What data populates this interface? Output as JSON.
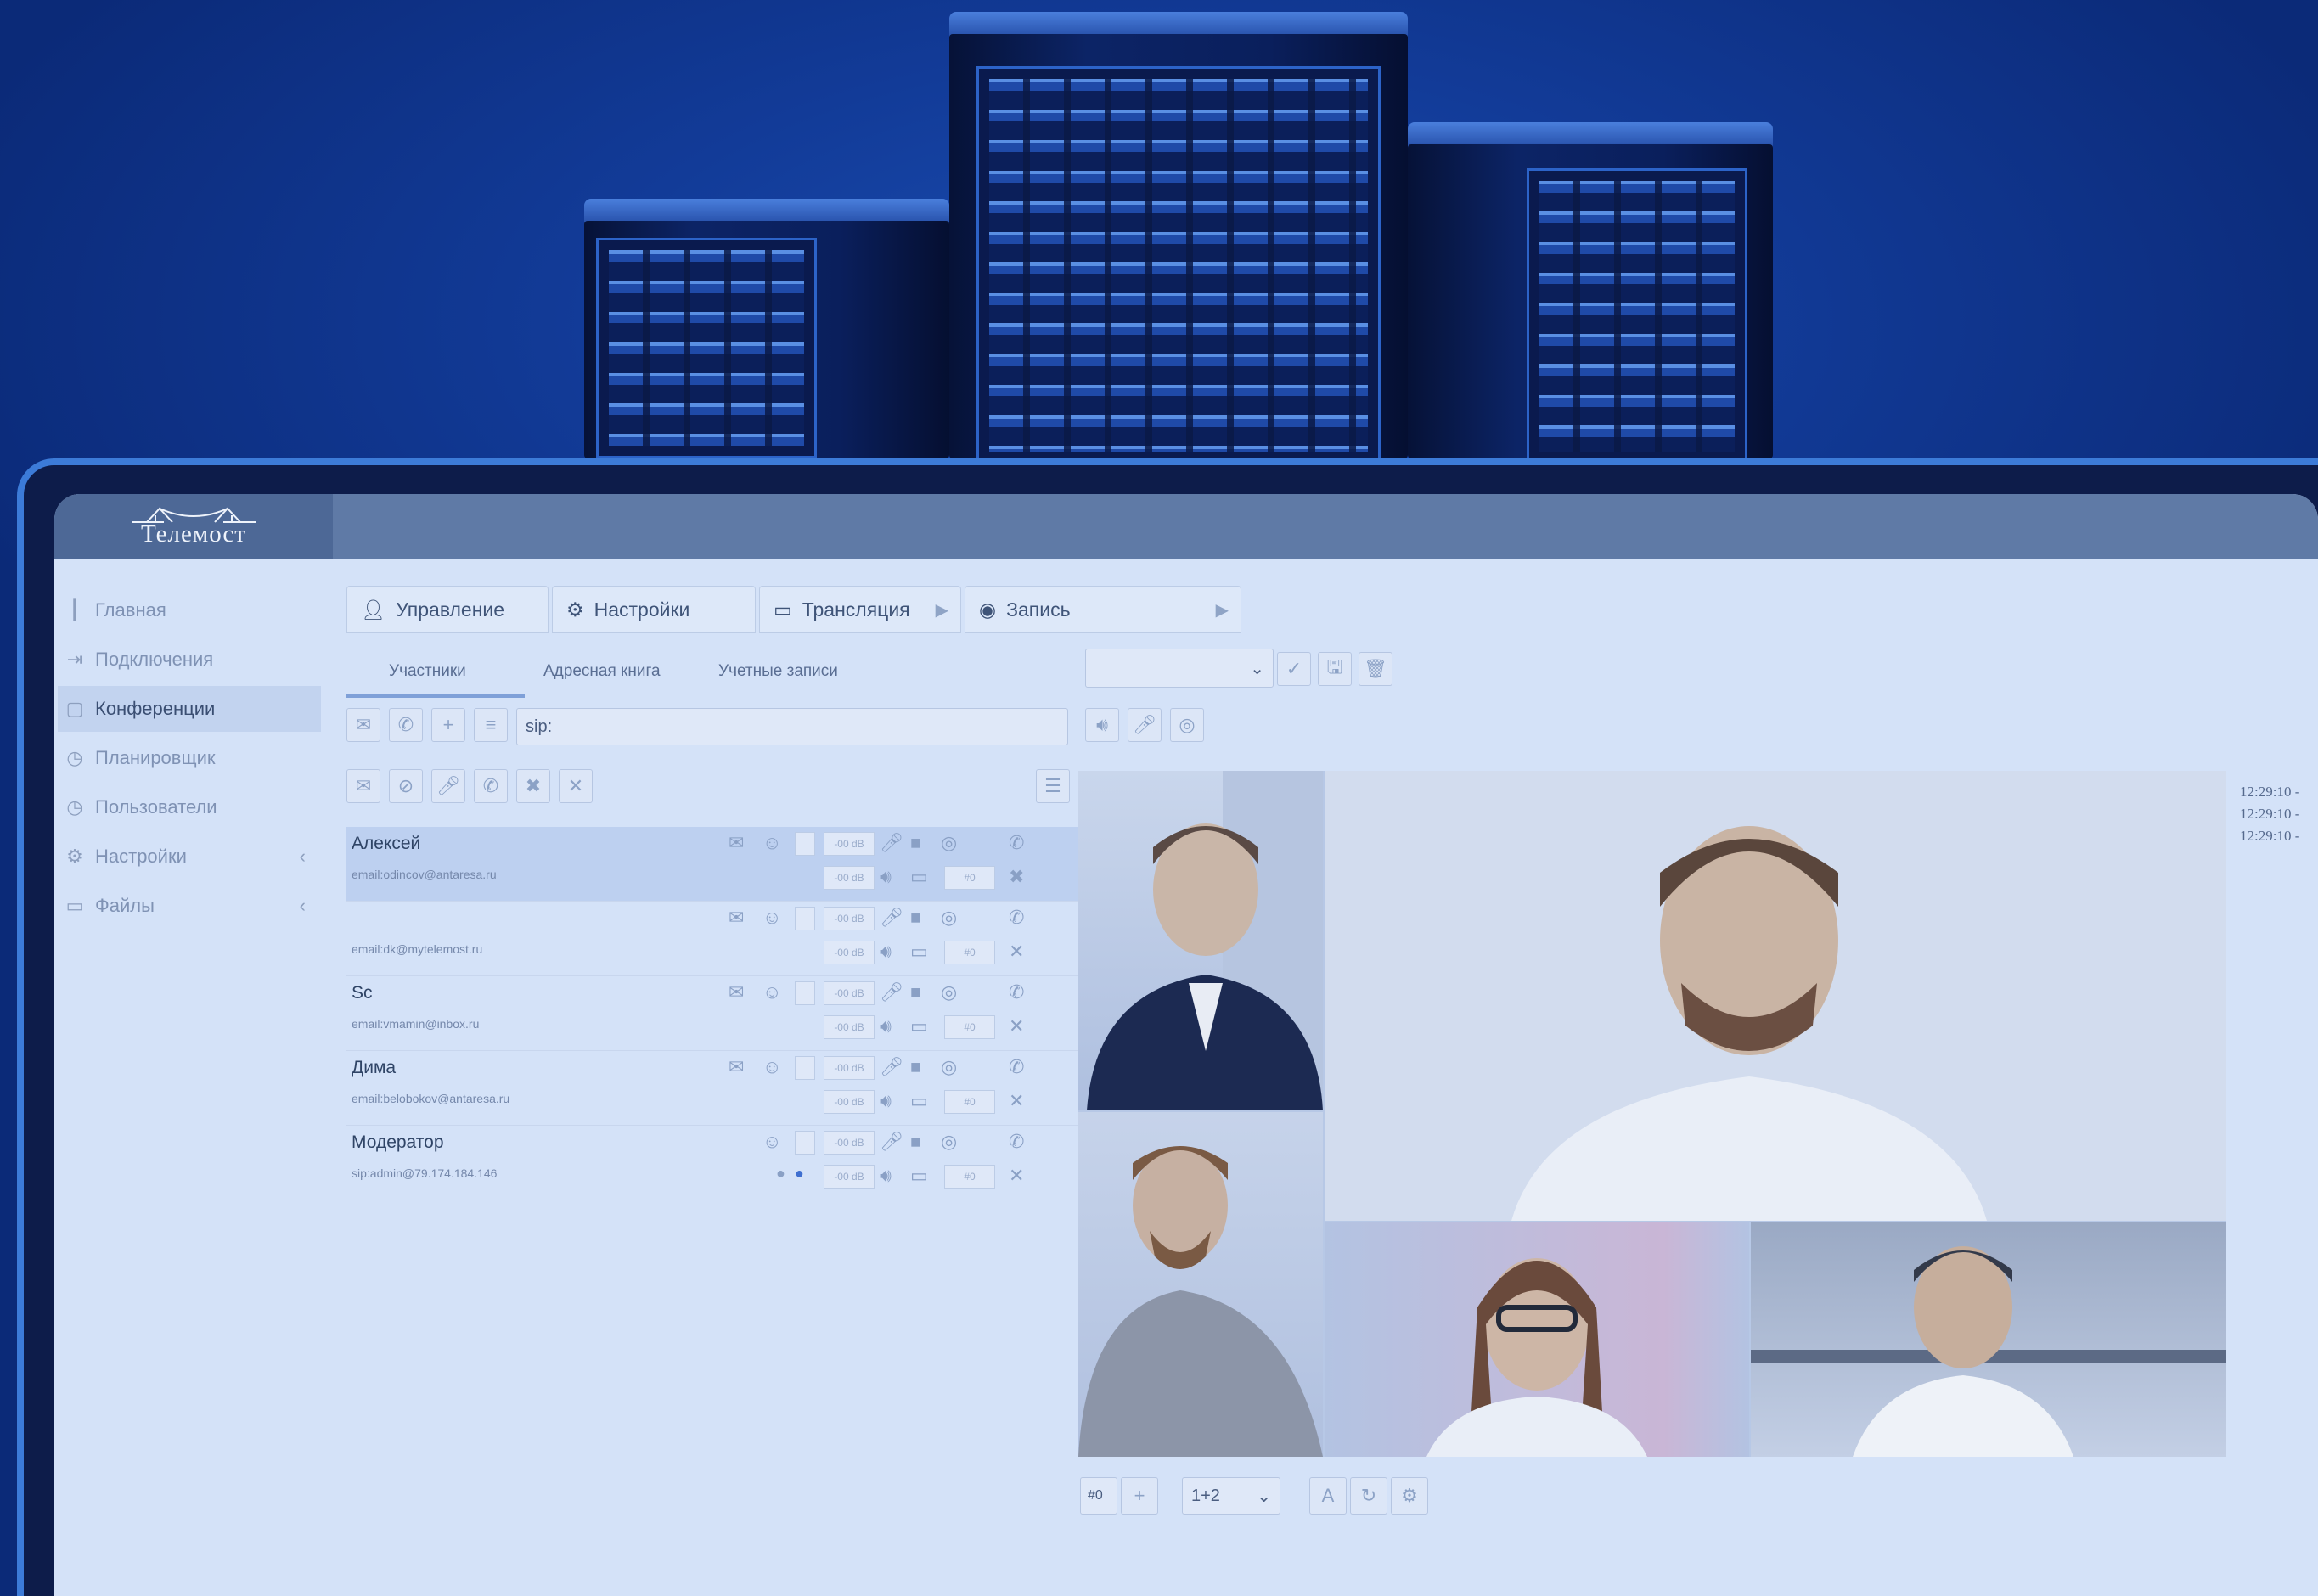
{
  "app": {
    "logo_text": "Телемост"
  },
  "sidebar": {
    "items": [
      {
        "label": "Главная",
        "icon": "bar-chart-icon"
      },
      {
        "label": "Подключения",
        "icon": "login-arrow-icon"
      },
      {
        "label": "Конференции",
        "icon": "screen-icon",
        "active": true
      },
      {
        "label": "Планировщик",
        "icon": "clock-icon"
      },
      {
        "label": "Пользователи",
        "icon": "clock-icon"
      },
      {
        "label": "Настройки",
        "icon": "gear-icon",
        "has_chevron": true
      },
      {
        "label": "Файлы",
        "icon": "folder-icon",
        "has_chevron": true
      }
    ]
  },
  "tabs": [
    {
      "label": "Управление",
      "icon": "user-icon"
    },
    {
      "label": "Настройки",
      "icon": "gear-icon"
    },
    {
      "label": "Трансляция",
      "icon": "cast-icon"
    },
    {
      "label": "Запись",
      "icon": "record-icon"
    }
  ],
  "subtabs": [
    "Участники",
    "Адресная книга",
    "Учетные записи"
  ],
  "sip_input": {
    "value": "sip:"
  },
  "participants": [
    {
      "name": "Алексей",
      "email": "email:odincov@antaresa.ru",
      "db": "-00 dB",
      "num": "#0",
      "selected": true
    },
    {
      "name": "",
      "email": "email:dk@mytelemost.ru",
      "db": "-00 dB",
      "num": "#0"
    },
    {
      "name": "Sc",
      "email": "email:vmamin@inbox.ru",
      "db": "-00 dB",
      "num": "#0"
    },
    {
      "name": "Дима",
      "email": "email:belobokov@antaresa.ru",
      "db": "-00 dB",
      "num": "#0"
    },
    {
      "name": "Модератор",
      "email": "sip:admin@79.174.184.146",
      "db": "-00 dB",
      "num": "#0"
    }
  ],
  "log": [
    "12:29:10 -",
    "12:29:10 -",
    "12:29:10 -"
  ],
  "bottom_tools": {
    "num": "#0",
    "layout": "1+2"
  },
  "colors": {
    "background": "#0b2a78",
    "screen": "#d4e2f8",
    "accent": "#3c7bd8"
  }
}
